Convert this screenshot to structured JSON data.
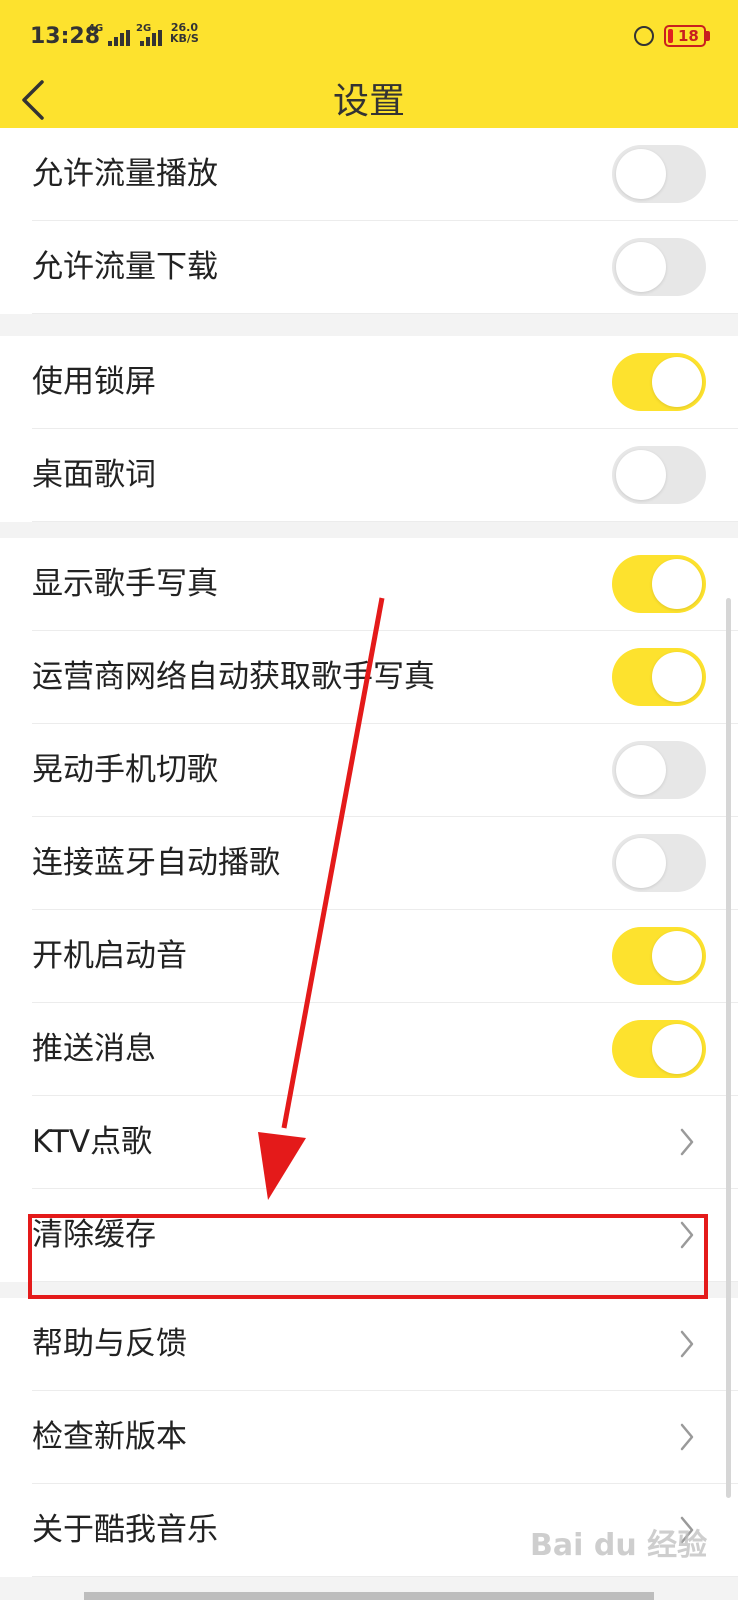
{
  "status_bar": {
    "time": "13:28",
    "network_1": "4G",
    "network_2": "2G",
    "speed_value": "26.0",
    "speed_unit": "KB/S",
    "battery": "18"
  },
  "header": {
    "title": "设置",
    "background_color": "#fde22e"
  },
  "settings": [
    {
      "label": "允许流量播放",
      "type": "toggle",
      "on": false
    },
    {
      "label": "允许流量下载",
      "type": "toggle",
      "on": false
    },
    {
      "label": "使用锁屏",
      "type": "toggle",
      "on": true
    },
    {
      "label": "桌面歌词",
      "type": "toggle",
      "on": false
    },
    {
      "label": "显示歌手写真",
      "type": "toggle",
      "on": true
    },
    {
      "label": "运营商网络自动获取歌手写真",
      "type": "toggle",
      "on": true
    },
    {
      "label": "晃动手机切歌",
      "type": "toggle",
      "on": false
    },
    {
      "label": "连接蓝牙自动播歌",
      "type": "toggle",
      "on": false
    },
    {
      "label": "开机启动音",
      "type": "toggle",
      "on": true
    },
    {
      "label": "推送消息",
      "type": "toggle",
      "on": true
    },
    {
      "label": "KTV点歌",
      "type": "link"
    },
    {
      "label": "清除缓存",
      "type": "link"
    },
    {
      "label": "帮助与反馈",
      "type": "link"
    },
    {
      "label": "检查新版本",
      "type": "link"
    },
    {
      "label": "关于酷我音乐",
      "type": "link"
    }
  ],
  "watermark": "Bai du 经验",
  "colors": {
    "accent": "#fde22e",
    "toggle_off": "#e7e7e7",
    "annotation": "#e41a1a"
  }
}
